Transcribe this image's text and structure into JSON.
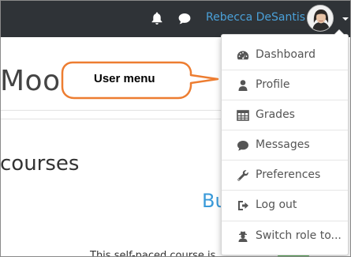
{
  "navbar": {
    "icons": [
      "bell-icon",
      "chat-icon"
    ],
    "username": "Rebecca DeSantis"
  },
  "page": {
    "heading": "Moo",
    "section_heading": "courses",
    "course_link": "Bu",
    "course_text": "This self-paced course is"
  },
  "user_menu": {
    "items": [
      {
        "label": "Dashboard",
        "icon": "dashboard-icon"
      },
      {
        "label": "Profile",
        "icon": "user-icon"
      },
      {
        "label": "Grades",
        "icon": "table-icon"
      },
      {
        "label": "Messages",
        "icon": "speech-bubble-icon"
      },
      {
        "label": "Preferences",
        "icon": "wrench-icon"
      },
      {
        "label": "Log out",
        "icon": "sign-out-icon"
      },
      {
        "label": "Switch role to...",
        "icon": "user-secret-icon"
      }
    ]
  },
  "annotation": {
    "callout_label": "User menu",
    "color": "#ed7d31"
  }
}
